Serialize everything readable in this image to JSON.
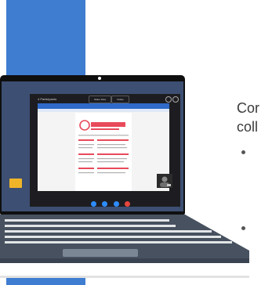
{
  "slide": {
    "text_partial_line1": "Cor",
    "text_partial_line2": "coll"
  },
  "screen_app": {
    "title": "4 Participants",
    "buttons": [
      "Share Files",
      "Invites"
    ],
    "call_controls": [
      "video",
      "mic",
      "screen-share",
      "end-call"
    ]
  },
  "colors": {
    "slide_blue": "#3f7dd1",
    "accent_yellow": "#f0b429",
    "doc_blue": "#2f6ac9",
    "doc_red": "#e84a5a",
    "call_blue": "#2d8cff",
    "end_call_red": "#e5463d"
  }
}
